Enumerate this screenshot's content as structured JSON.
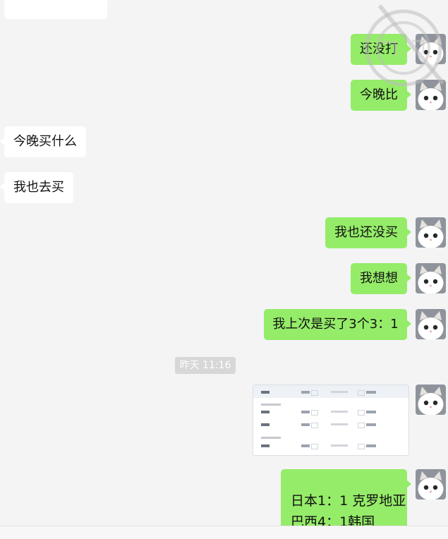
{
  "messages": [
    {
      "side": "right",
      "text": "还没打"
    },
    {
      "side": "right",
      "text": "今晚比"
    },
    {
      "side": "left",
      "text": "今晚买什么"
    },
    {
      "side": "left",
      "text": "我也去买"
    },
    {
      "side": "right",
      "text": "我也还没买"
    },
    {
      "side": "right",
      "text": "我想想"
    },
    {
      "side": "right",
      "text": "我上次是买了3个3：1"
    },
    {
      "side": "timestamp",
      "text": "昨天 11:16"
    },
    {
      "side": "right",
      "type": "image",
      "description_icon": "match-schedule-screenshot"
    },
    {
      "side": "right",
      "lines": [
        "日本1：1 克罗地亚",
        "巴西4：1韩国"
      ]
    }
  ],
  "colors": {
    "background": "#f4f4f5",
    "outgoing_bubble": "#95ec69",
    "incoming_bubble": "#ffffff",
    "timestamp_bg": "#d7d7d8"
  },
  "icons": {
    "avatar": "cat-avatar-icon",
    "watermark": "watermark-logo-icon"
  }
}
